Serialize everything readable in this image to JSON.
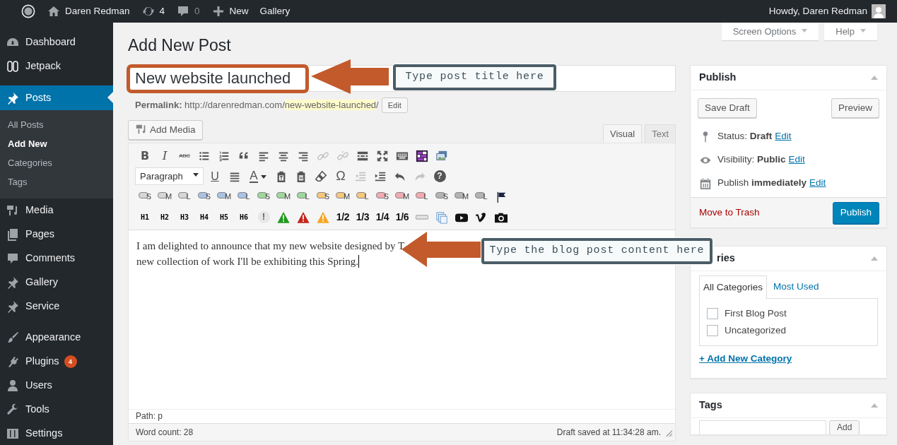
{
  "admin_bar": {
    "items": [
      {
        "kind": "logo"
      },
      {
        "kind": "home",
        "label": "Daren Redman"
      },
      {
        "kind": "updates",
        "label": "4"
      },
      {
        "kind": "comments",
        "label": "0"
      },
      {
        "kind": "new",
        "label": "New"
      },
      {
        "kind": "plain",
        "label": "Gallery"
      }
    ],
    "greeting": "Howdy, Daren Redman"
  },
  "sidebar": {
    "groups": [
      [
        {
          "kind": "dashboard",
          "label": "Dashboard",
          "selected": false
        },
        {
          "kind": "jetpack",
          "label": "Jetpack",
          "selected": false
        }
      ],
      [
        {
          "kind": "pin",
          "label": "Posts",
          "selected": true,
          "children": [
            {
              "label": "All Posts",
              "selected": false
            },
            {
              "label": "Add New",
              "selected": true
            },
            {
              "label": "Categories",
              "selected": false
            },
            {
              "label": "Tags",
              "selected": false
            }
          ]
        },
        {
          "kind": "media",
          "label": "Media",
          "selected": false
        },
        {
          "kind": "pages",
          "label": "Pages",
          "selected": false
        },
        {
          "kind": "comments",
          "label": "Comments",
          "selected": false
        },
        {
          "kind": "pin",
          "label": "Gallery",
          "selected": false
        },
        {
          "kind": "pin",
          "label": "Service",
          "selected": false
        }
      ],
      [
        {
          "kind": "brush",
          "label": "Appearance",
          "selected": false
        },
        {
          "kind": "plug",
          "label": "Plugins",
          "selected": false,
          "badge": "4"
        },
        {
          "kind": "user",
          "label": "Users",
          "selected": false
        },
        {
          "kind": "wrench",
          "label": "Tools",
          "selected": false
        },
        {
          "kind": "sliders",
          "label": "Settings",
          "selected": false
        }
      ]
    ]
  },
  "screen_buttons": [
    "Screen Options",
    "Help"
  ],
  "page_title": "Add New Post",
  "post_title": {
    "value": "New website launched"
  },
  "permalink": {
    "label": "Permalink:",
    "base": "http://darenredman.com/",
    "slug": "new-website-launched",
    "trailing": "/",
    "button": "Edit"
  },
  "editor": {
    "add_media": "Add Media",
    "tabs": [
      {
        "label": "Visual",
        "selected": true
      },
      {
        "label": "Text",
        "selected": false
      }
    ],
    "toolbar_rows": [
      [
        {
          "kind": "bold",
          "label": "B",
          "disabled": false
        },
        {
          "kind": "italic",
          "label": "I",
          "disabled": false
        },
        {
          "kind": "strike",
          "label": "ABC",
          "disabled": false
        },
        {
          "kind": "ul",
          "disabled": false
        },
        {
          "kind": "ol",
          "disabled": false
        },
        {
          "kind": "quote",
          "disabled": false
        },
        {
          "kind": "al",
          "disabled": false
        },
        {
          "kind": "ac",
          "disabled": false
        },
        {
          "kind": "ar",
          "disabled": false
        },
        {
          "kind": "link",
          "disabled": true
        },
        {
          "kind": "unlink",
          "disabled": true
        },
        {
          "kind": "more",
          "disabled": false
        },
        {
          "kind": "fullscreen",
          "disabled": false
        },
        {
          "kind": "kitchen",
          "disabled": false
        },
        {
          "kind": "grid",
          "disabled": false
        },
        {
          "kind": "image",
          "disabled": false
        }
      ],
      [
        {
          "kind": "select",
          "label": "Paragraph",
          "disabled": false
        },
        {
          "kind": "underline",
          "label": "U",
          "disabled": false
        },
        {
          "kind": "justify",
          "disabled": false
        },
        {
          "kind": "textcolor",
          "label": "A",
          "disabled": false
        },
        {
          "kind": "clip",
          "disabled": false
        },
        {
          "kind": "clip2",
          "disabled": false
        },
        {
          "kind": "eraser",
          "disabled": false
        },
        {
          "kind": "omega",
          "label": "Ω",
          "disabled": false
        },
        {
          "kind": "outdent",
          "disabled": true
        },
        {
          "kind": "indent",
          "disabled": false
        },
        {
          "kind": "undo",
          "disabled": false
        },
        {
          "kind": "redo",
          "disabled": true
        },
        {
          "kind": "help",
          "label": "?",
          "disabled": false
        }
      ],
      [
        {
          "kind": "bubble",
          "label": "S",
          "color": "#d6d6d6"
        },
        {
          "kind": "bubble",
          "label": "M",
          "color": "#d6d6d6"
        },
        {
          "kind": "bubble",
          "label": "L",
          "color": "#d6d6d6"
        },
        {
          "kind": "bubble",
          "label": "S",
          "color": "#a9c3e6"
        },
        {
          "kind": "bubble",
          "label": "M",
          "color": "#a9c3e6"
        },
        {
          "kind": "bubble",
          "label": "L",
          "color": "#a9c3e6"
        },
        {
          "kind": "bubble",
          "label": "S",
          "color": "#9fd89c"
        },
        {
          "kind": "bubble",
          "label": "M",
          "color": "#9fd89c"
        },
        {
          "kind": "bubble",
          "label": "L",
          "color": "#9fd89c"
        },
        {
          "kind": "bubble",
          "label": "S",
          "color": "#f6c77c"
        },
        {
          "kind": "bubble",
          "label": "M",
          "color": "#f6c77c"
        },
        {
          "kind": "bubble",
          "label": "L",
          "color": "#f6c77c"
        },
        {
          "kind": "bubble",
          "label": "S",
          "color": "#f3a9b2"
        },
        {
          "kind": "bubble",
          "label": "M",
          "color": "#f3a9b2"
        },
        {
          "kind": "bubble",
          "label": "L",
          "color": "#f3a9b2"
        },
        {
          "kind": "bubble",
          "label": "S",
          "color": "#b3b3b3"
        },
        {
          "kind": "bubble",
          "label": "M",
          "color": "#b3b3b3"
        },
        {
          "kind": "bubble",
          "label": "L",
          "color": "#b3b3b3"
        },
        {
          "kind": "flag"
        }
      ],
      [
        {
          "kind": "heading",
          "label": "H1"
        },
        {
          "kind": "heading",
          "label": "H2"
        },
        {
          "kind": "heading",
          "label": "H3"
        },
        {
          "kind": "heading",
          "label": "H4"
        },
        {
          "kind": "heading",
          "label": "H5"
        },
        {
          "kind": "heading",
          "label": "H6"
        },
        {
          "kind": "alert",
          "label": "!"
        },
        {
          "kind": "warning",
          "color": "#1c9a1c"
        },
        {
          "kind": "warning",
          "color": "#c4261c"
        },
        {
          "kind": "warning",
          "color": "#f5a623"
        },
        {
          "kind": "fraction",
          "label": "1/2"
        },
        {
          "kind": "fraction",
          "label": "1/3"
        },
        {
          "kind": "fraction",
          "label": "1/4"
        },
        {
          "kind": "fraction",
          "label": "1/6"
        },
        {
          "kind": "hr"
        },
        {
          "kind": "copy"
        },
        {
          "kind": "play"
        },
        {
          "kind": "vlogo"
        },
        {
          "kind": "camera"
        }
      ]
    ],
    "content_lines": [
      "I am delighted to announce that my new website designed by T",
      "new collection of work I'll be exhibiting this Spring."
    ],
    "path": "Path: p",
    "word_count": "Word count: 28",
    "draft_saved": "Draft saved at 11:34:28 am."
  },
  "annotations": [
    "Type post title here",
    "Type the blog post content here"
  ],
  "publish_box": {
    "title": "Publish",
    "save_draft": "Save Draft",
    "preview": "Preview",
    "rows": [
      {
        "kind": "status",
        "text": "Status: **Draft**",
        "link": "Edit"
      },
      {
        "kind": "visibility",
        "text": "Visibility: **Public**",
        "link": "Edit"
      },
      {
        "kind": "schedule",
        "text": "Publish **immediately**",
        "link": "Edit"
      }
    ],
    "trash": "Move to Trash",
    "publish": "Publish"
  },
  "categories_box": {
    "title": "ries",
    "tabs": [
      {
        "label": "All Categories",
        "selected": true
      },
      {
        "label": "Most Used",
        "selected": false
      }
    ],
    "items": [
      {
        "label": "First Blog Post",
        "checked": false
      },
      {
        "label": "Uncategorized",
        "checked": false
      }
    ],
    "add_link": "+ Add New Category"
  },
  "tags_box": {
    "title": "Tags",
    "button": "Add"
  }
}
